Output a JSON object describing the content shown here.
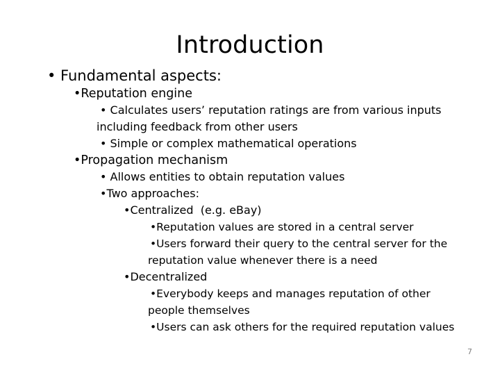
{
  "slide": {
    "title": "Introduction",
    "page_number": "7",
    "background_color": "#ffffff",
    "text_color": "#000000",
    "page_number_color": "#7f7f7f",
    "lines": [
      {
        "level": 1,
        "wrap": false,
        "text": "• Fundamental aspects:"
      },
      {
        "level": 2,
        "wrap": false,
        "text": "•Reputation engine"
      },
      {
        "level": 3,
        "wrap": false,
        "text": "• Calculates users’ reputation ratings are from various inputs"
      },
      {
        "level": 3,
        "wrap": true,
        "text": "including feedback from other users"
      },
      {
        "level": 3,
        "wrap": false,
        "text": "• Simple or complex mathematical operations"
      },
      {
        "level": 2,
        "wrap": false,
        "text": "•Propagation mechanism"
      },
      {
        "level": 3,
        "wrap": false,
        "text": "• Allows entities to obtain reputation values"
      },
      {
        "level": 3,
        "wrap": false,
        "text": "•Two approaches:"
      },
      {
        "level": 4,
        "wrap": false,
        "text": "•Centralized  (e.g. eBay)"
      },
      {
        "level": 5,
        "wrap": false,
        "text": "•Reputation values are stored in a central server"
      },
      {
        "level": 5,
        "wrap": false,
        "text": "•Users forward their query to the central server for the"
      },
      {
        "level": 5,
        "wrap": true,
        "text": "reputation value whenever there is a need"
      },
      {
        "level": 4,
        "wrap": false,
        "text": "•Decentralized"
      },
      {
        "level": 5,
        "wrap": false,
        "text": "•Everybody keeps and manages reputation of other"
      },
      {
        "level": 5,
        "wrap": true,
        "text": "people themselves"
      },
      {
        "level": 5,
        "wrap": false,
        "text": "•Users can ask others for the required reputation values"
      }
    ]
  }
}
